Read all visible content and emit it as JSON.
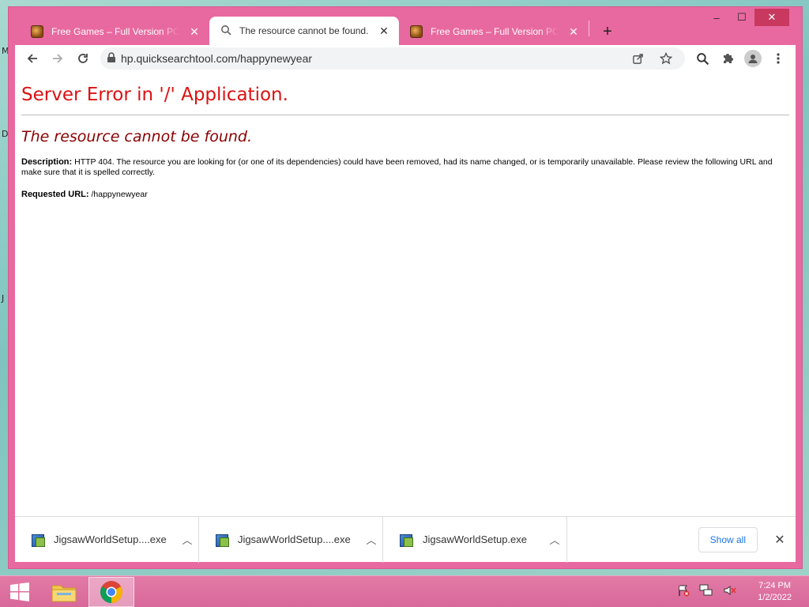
{
  "desktop": {
    "edge_labels": [
      "M",
      "D",
      "J"
    ]
  },
  "browser": {
    "tabs": [
      {
        "title": "Free Games – Full Version PC Ga",
        "favicon": "game-icon",
        "active": false
      },
      {
        "title": "The resource cannot be found.",
        "favicon": "search-icon",
        "active": true
      },
      {
        "title": "Free Games – Full Version PC Ga",
        "favicon": "game-icon",
        "active": false
      }
    ],
    "new_tab_label": "+",
    "window_controls": {
      "minimize": "–",
      "maximize": "☐",
      "close": "✕"
    },
    "address": "hp.quicksearchtool.com/happynewyear"
  },
  "page": {
    "heading": "Server Error in '/' Application.",
    "subheading": "The resource cannot be found.",
    "description_label": "Description:",
    "description_text": "HTTP 404. The resource you are looking for (or one of its dependencies) could have been removed, had its name changed, or is temporarily unavailable.  Please review the following URL and make sure that it is spelled correctly.",
    "requested_url_label": "Requested URL:",
    "requested_url_value": "/happynewyear"
  },
  "downloads": {
    "items": [
      {
        "name": "JigsawWorldSetup....exe"
      },
      {
        "name": "JigsawWorldSetup....exe"
      },
      {
        "name": "JigsawWorldSetup.exe"
      }
    ],
    "show_all_label": "Show all"
  },
  "taskbar": {
    "time": "7:24 PM",
    "date": "1/2/2022"
  },
  "colors": {
    "frame": "#e8699f",
    "error_red": "#dd1111",
    "subheading_red": "#8b0000",
    "link_blue": "#1a73e8"
  }
}
